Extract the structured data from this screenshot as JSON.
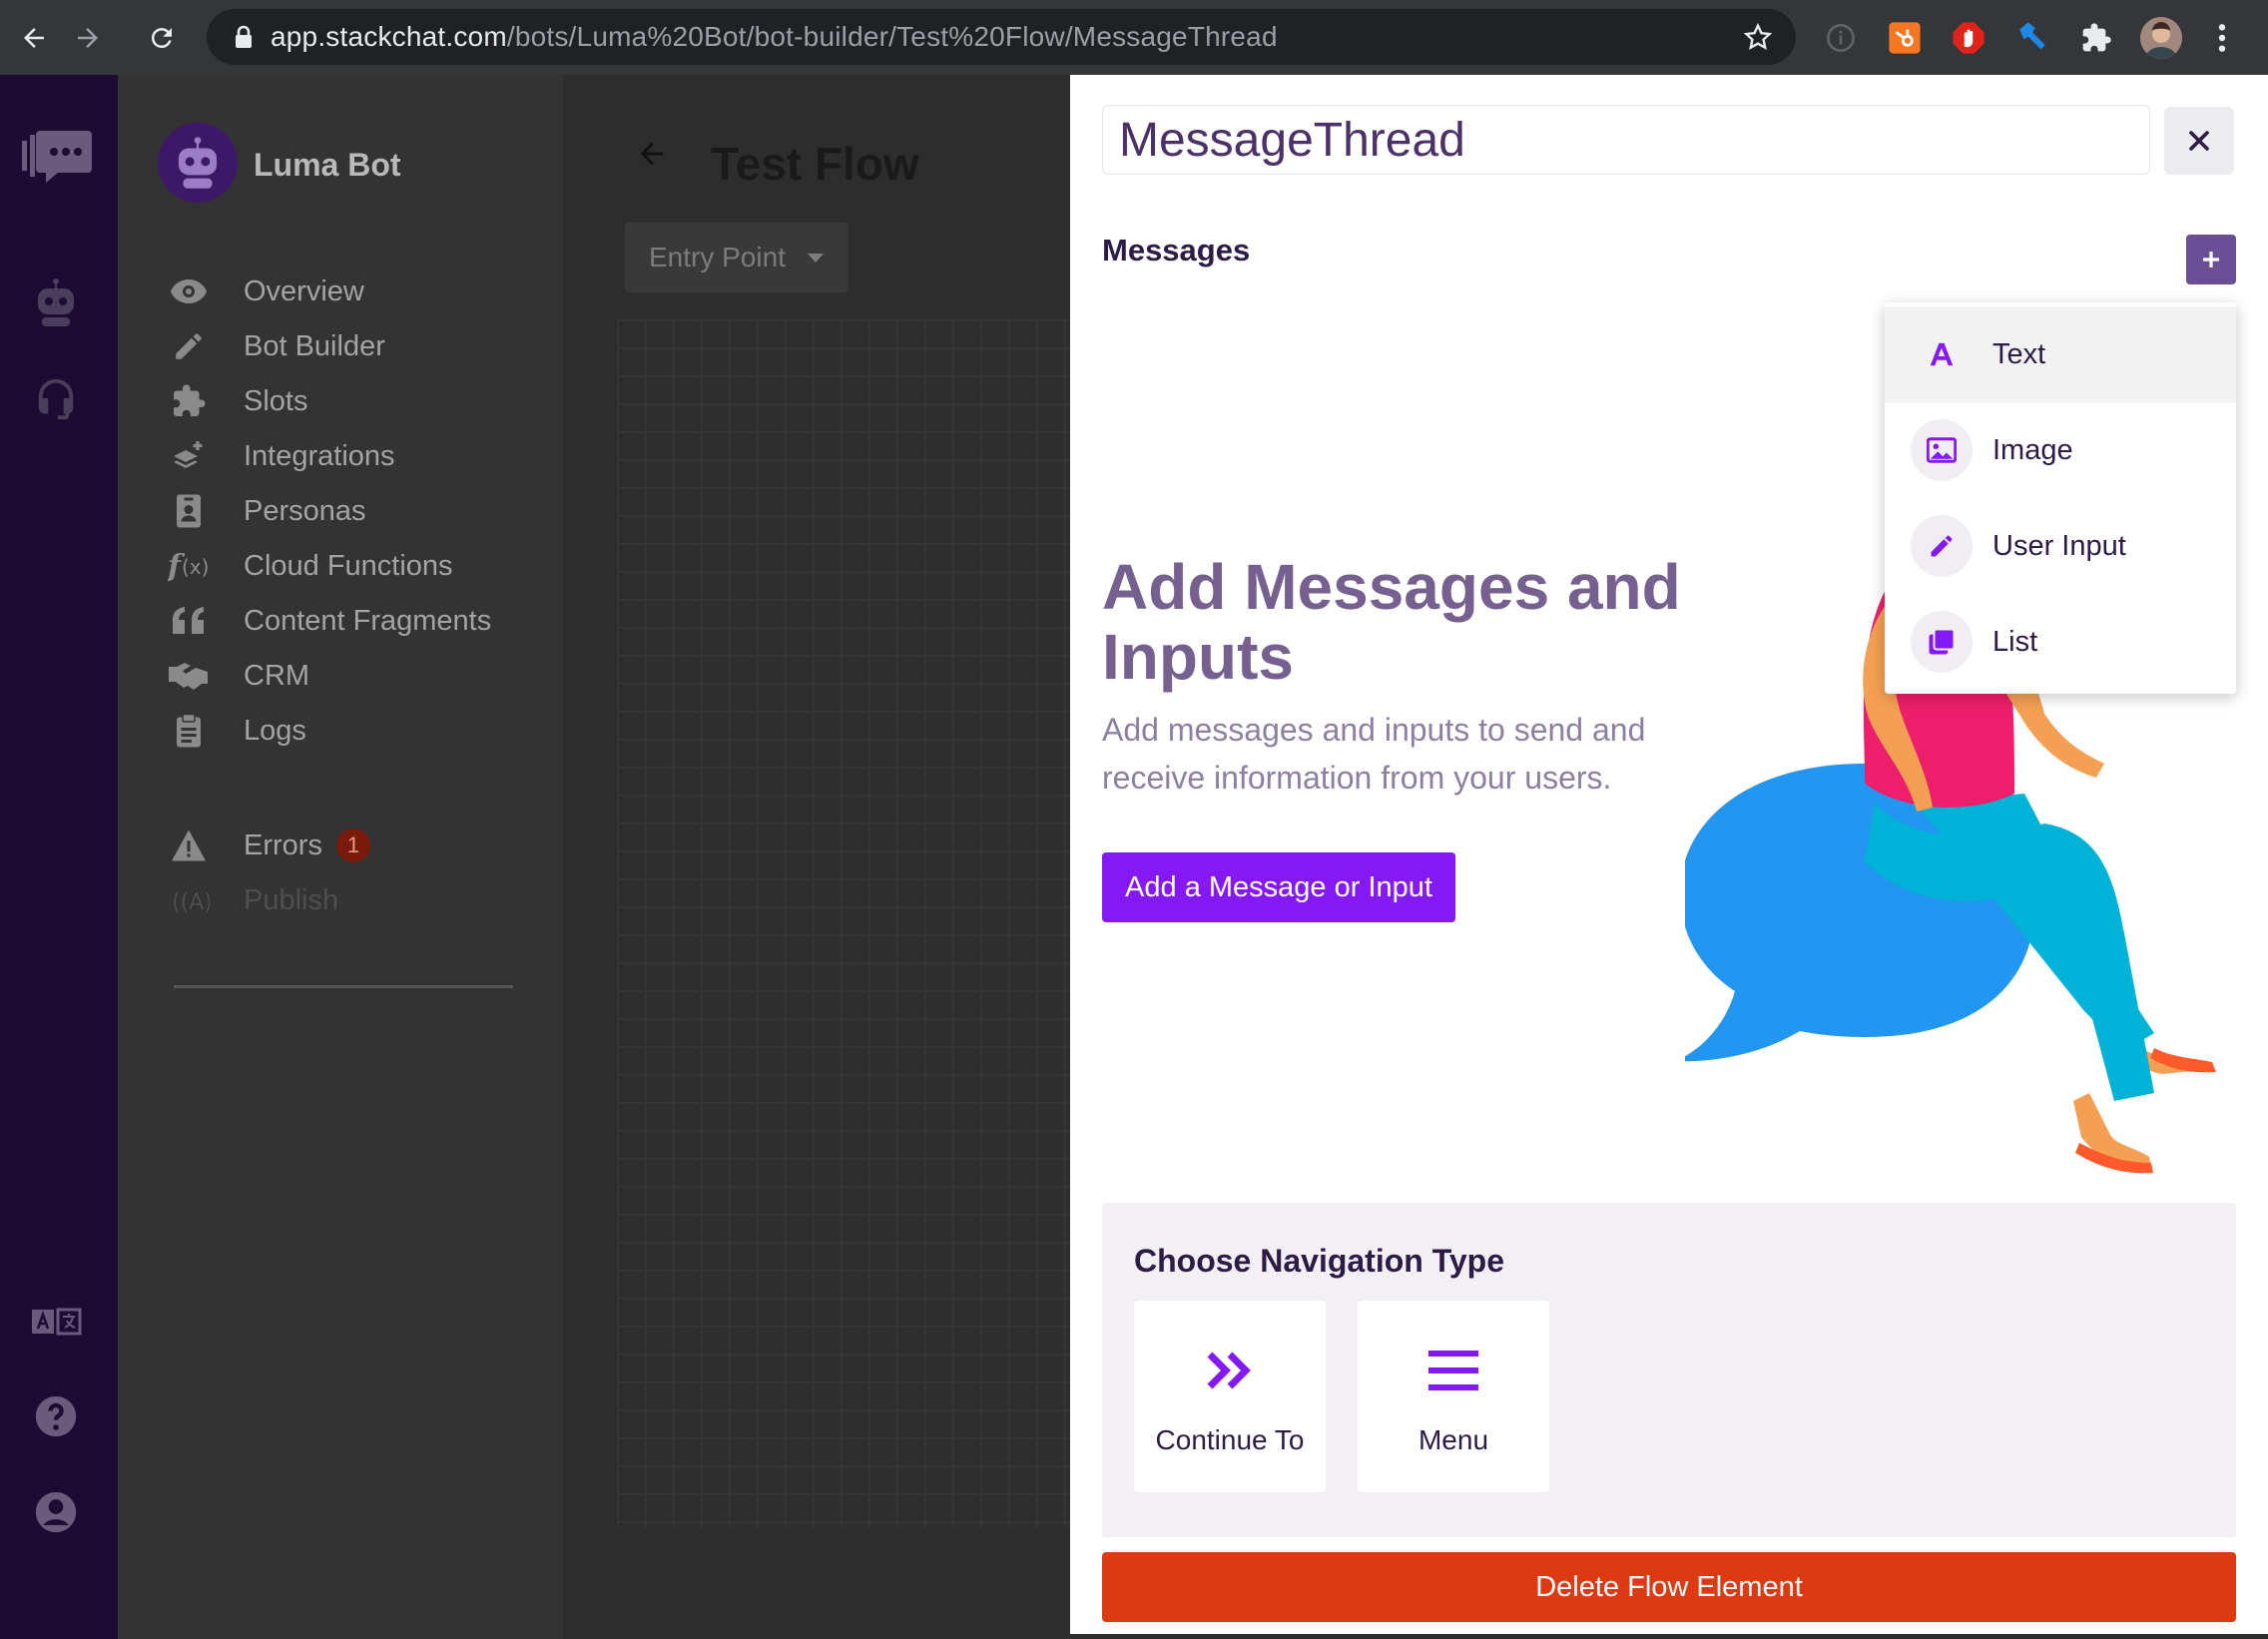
{
  "browser": {
    "url_host": "app.stackchat.com",
    "url_path": "/bots/Luma%20Bot/bot-builder/Test%20Flow/MessageThread"
  },
  "sidebar": {
    "bot_name": "Luma Bot",
    "items": [
      {
        "label": "Overview",
        "icon": "eye-icon"
      },
      {
        "label": "Bot Builder",
        "icon": "pencil-icon"
      },
      {
        "label": "Slots",
        "icon": "puzzle-icon"
      },
      {
        "label": "Integrations",
        "icon": "layers-plus-icon"
      },
      {
        "label": "Personas",
        "icon": "id-badge-icon"
      },
      {
        "label": "Cloud Functions",
        "icon": "function-icon"
      },
      {
        "label": "Content Fragments",
        "icon": "quote-icon"
      },
      {
        "label": "CRM",
        "icon": "handshake-icon"
      },
      {
        "label": "Logs",
        "icon": "clipboard-icon"
      }
    ],
    "errors_label": "Errors",
    "errors_count": "1",
    "publish_label": "Publish"
  },
  "main": {
    "title": "Test Flow",
    "entry_point": "Entry Point"
  },
  "panel": {
    "element_name": "MessageThread",
    "messages_title": "Messages",
    "empty_heading": "Add Messages and Inputs",
    "empty_desc": "Add messages and inputs to send and receive information from your users.",
    "cta_label": "Add a Message or Input",
    "dropdown": [
      {
        "label": "Text",
        "icon": "text-icon"
      },
      {
        "label": "Image",
        "icon": "image-icon"
      },
      {
        "label": "User Input",
        "icon": "pencil-icon"
      },
      {
        "label": "List",
        "icon": "list-stack-icon"
      }
    ],
    "nav_title": "Choose Navigation Type",
    "nav_options": [
      {
        "label": "Continue To",
        "icon": "double-chevron-right-icon"
      },
      {
        "label": "Menu",
        "icon": "hamburger-menu-icon"
      }
    ],
    "delete_label": "Delete Flow Element"
  },
  "colors": {
    "accent": "#8419f3",
    "rail": "#1d0b33",
    "danger": "#dd3a14",
    "heading": "#76608f"
  }
}
